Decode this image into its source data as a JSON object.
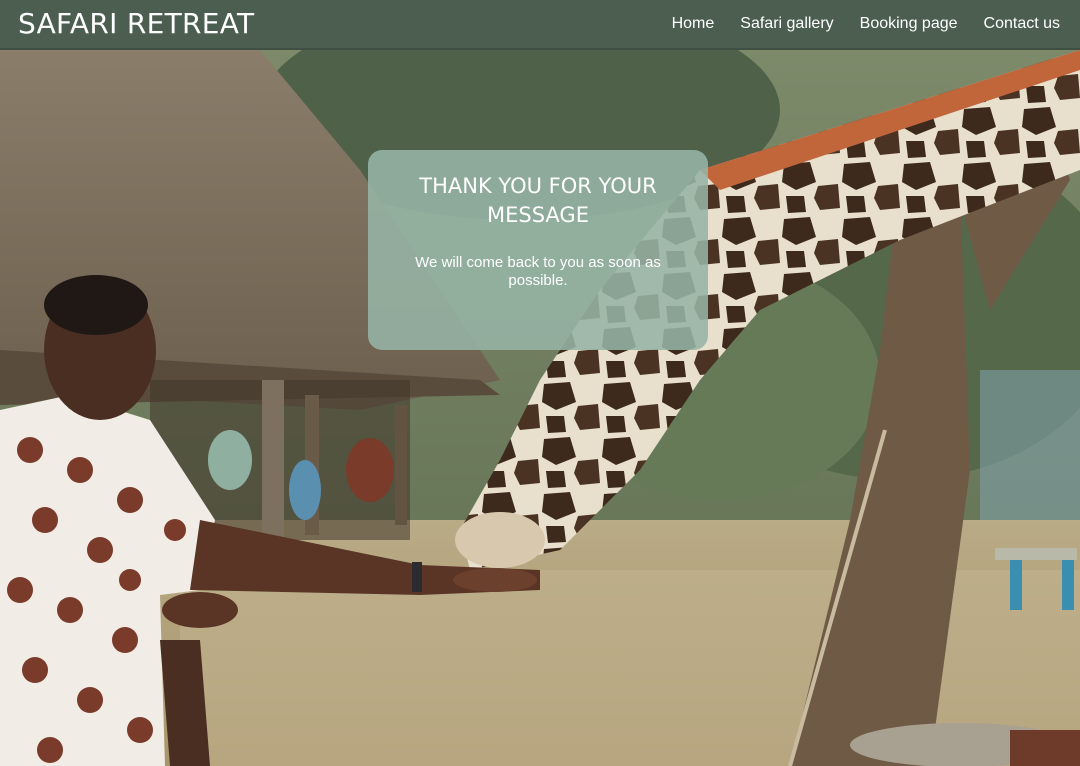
{
  "header": {
    "brand": "SAFARI RETREAT",
    "nav": [
      {
        "label": "Home"
      },
      {
        "label": "Safari gallery"
      },
      {
        "label": "Booking page"
      },
      {
        "label": "Contact us"
      }
    ]
  },
  "message": {
    "title": "THANK YOU FOR YOUR MESSAGE",
    "body": "We will come back to you as soon as possible."
  },
  "colors": {
    "header_bg": "#4b5e50",
    "card_bg": "#96b4a5"
  },
  "hero_image": {
    "icon": "giraffe-feeding-photo"
  }
}
